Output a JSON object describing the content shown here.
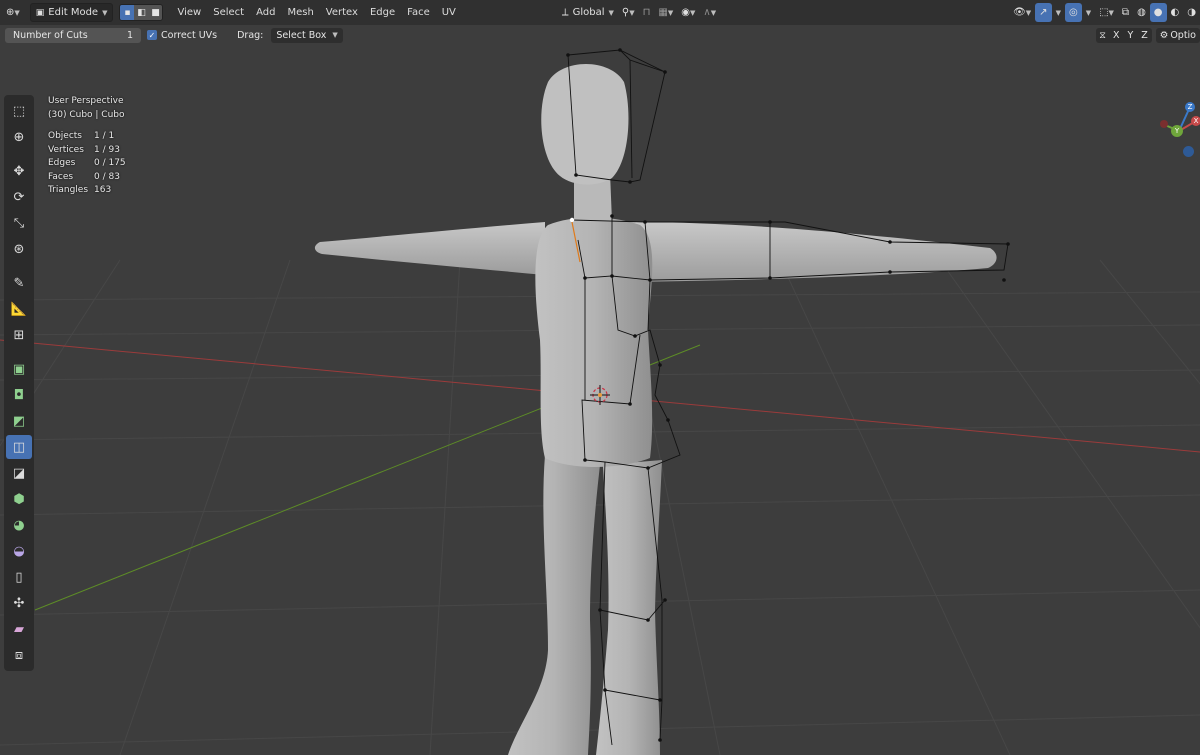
{
  "header": {
    "editor_type_icon": "view3d-icon",
    "mode": "Edit Mode",
    "select_modes": [
      "vertex-select-icon",
      "edge-select-icon",
      "face-select-icon"
    ],
    "menus": [
      "View",
      "Select",
      "Add",
      "Mesh",
      "Vertex",
      "Edge",
      "Face",
      "UV"
    ],
    "transform_orientation": "Global",
    "right_icons": [
      "visibility-icon",
      "gizmo-icon",
      "overlay-icon",
      "xray-icon",
      "wireframe-shading-icon",
      "solid-shading-icon",
      "material-shading-icon",
      "rendered-shading-icon"
    ]
  },
  "tool_settings": {
    "number_of_cuts_label": "Number of Cuts",
    "number_of_cuts_value": "1",
    "correct_uvs_label": "Correct UVs",
    "drag_label": "Drag:",
    "drag_value": "Select Box",
    "axis_x": "X",
    "axis_y": "Y",
    "axis_z": "Z",
    "options_label": "Optio"
  },
  "viewport": {
    "view_name": "User Perspective",
    "object_name": "(30) Cubo | Cubo",
    "stats": [
      {
        "label": "Objects",
        "value": "1 / 1"
      },
      {
        "label": "Vertices",
        "value": "1 / 93"
      },
      {
        "label": "Edges",
        "value": "0 / 175"
      },
      {
        "label": "Faces",
        "value": "0 / 83"
      },
      {
        "label": "Triangles",
        "value": "163"
      }
    ],
    "gizmo_z_label": "Z",
    "gizmo_y_label": "Y",
    "gizmo_x_label": "X"
  },
  "toolbar": {
    "tools": [
      "select-box-icon",
      "cursor-icon",
      "move-icon",
      "rotate-icon",
      "scale-icon",
      "transform-icon",
      "annotate-icon",
      "measure-icon",
      "add-cube-icon",
      "extrude-region-icon",
      "inset-faces-icon",
      "bevel-icon",
      "loop-cut-icon",
      "knife-icon",
      "poly-build-icon",
      "spin-icon",
      "smooth-icon",
      "edge-slide-icon",
      "shrink-fatten-icon",
      "shear-icon",
      "rip-region-icon"
    ],
    "active_tool": "loop-cut-icon"
  },
  "colors": {
    "header_bg": "#303030",
    "viewport_bg": "#3d3d3d",
    "accent_blue": "#4772b3",
    "axis_x_red": "#a33b3b",
    "axis_y_green": "#6a9b2e",
    "mesh_gray": "#b3b3b3"
  }
}
